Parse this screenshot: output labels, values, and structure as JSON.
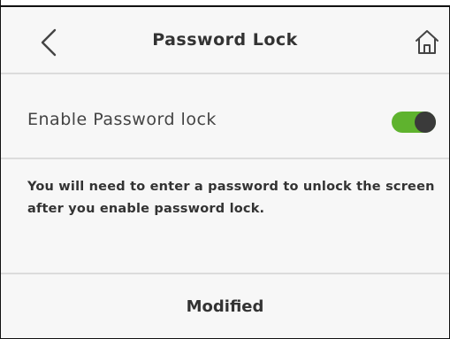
{
  "header": {
    "title": "Password Lock",
    "back_icon": "chevron-left-icon",
    "home_icon": "home-icon"
  },
  "settings": {
    "password_lock": {
      "label": "Enable Password lock",
      "enabled": true,
      "on_color": "#5fb32e",
      "knob_color": "#3a3a3a"
    },
    "description": "You will need to enter a password to unlock the screen after you enable password lock."
  },
  "footer": {
    "modified_label": "Modified"
  }
}
